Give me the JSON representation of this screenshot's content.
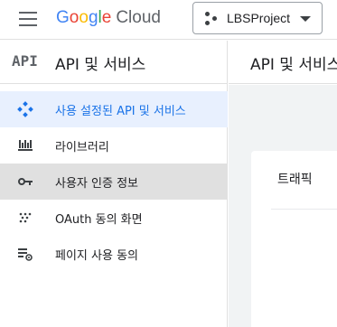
{
  "header": {
    "logo": {
      "google": "Google",
      "cloud": "Cloud"
    },
    "project": "LBSProject"
  },
  "sidebar": {
    "badge": "API",
    "title": "API 및 서비스",
    "items": [
      {
        "label": "사용 설정된 API 및 서비스",
        "icon": "diamond-dots-icon",
        "state": "active"
      },
      {
        "label": "라이브러리",
        "icon": "library-icon",
        "state": "normal"
      },
      {
        "label": "사용자 인증 정보",
        "icon": "key-icon",
        "state": "selected"
      },
      {
        "label": "OAuth 동의 화면",
        "icon": "dot-grid-icon",
        "state": "normal"
      },
      {
        "label": "페이지 사용 동의",
        "icon": "settings-list-icon",
        "state": "normal"
      }
    ]
  },
  "main": {
    "title": "API 및 서비스",
    "card_title": "트래픽"
  },
  "colors": {
    "accent": "#1a73e8",
    "active_bg": "#e8f0fe",
    "selected_bg": "#e0e0e0",
    "google_blue": "#4285f4",
    "google_red": "#ea4335",
    "google_yellow": "#fbbc05",
    "google_green": "#34a853"
  }
}
